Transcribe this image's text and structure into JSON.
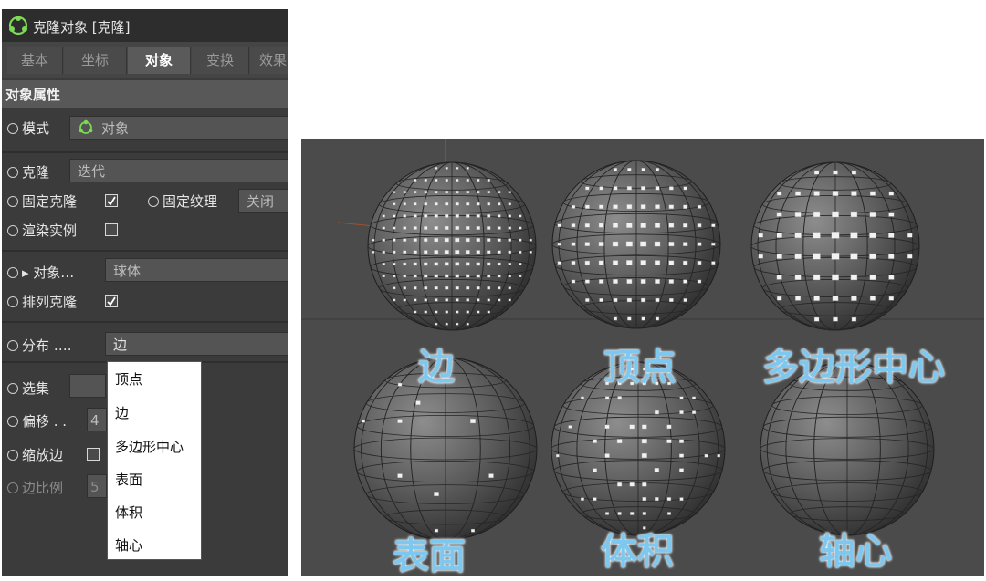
{
  "panel": {
    "header_title": "克隆对象 [克隆]",
    "tabs": [
      "基本",
      "坐标",
      "对象",
      "变换",
      "效果"
    ],
    "active_tab": "对象",
    "section_title": "对象属性",
    "rows": {
      "mode_label": "模式",
      "mode_value": "对象",
      "clone_label": "克隆",
      "clone_value": "迭代",
      "fixed_clone_label": "固定克隆",
      "fixed_texture_label": "固定纹理",
      "fixed_texture_value": "关闭",
      "render_instances_label": "渲染实例",
      "object_label": "▸ 对象…",
      "object_value": "球体",
      "arrange_clones_label": "排列克隆",
      "distribution_label": "分布 ….",
      "distribution_value": "边",
      "selection_label": "选集",
      "offset_label": "偏移 . .",
      "offset_value": "4",
      "scale_edge_label": "缩放边",
      "edge_ratio_label": "边比例",
      "edge_ratio_value": "5"
    },
    "dropdown_options": [
      "顶点",
      "边",
      "多边形中心",
      "表面",
      "体积",
      "轴心"
    ]
  },
  "viewport": {
    "captions": [
      "边",
      "顶点",
      "多边形中心",
      "表面",
      "体积",
      "轴心"
    ]
  },
  "colors": {
    "caption": "#7ec8f0",
    "dropdown_border": "#c62828",
    "panel_bg": "#3b3b3b",
    "viewport_bg": "#4b4b4b"
  }
}
